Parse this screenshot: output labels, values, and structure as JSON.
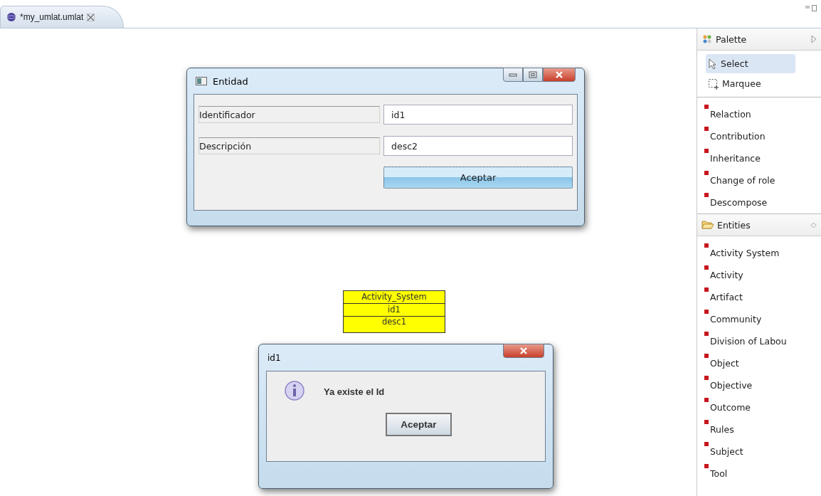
{
  "editor_tab": {
    "title": "*my_umlat.umlat"
  },
  "entity_dialog": {
    "title": "Entidad",
    "fields": [
      {
        "label": "Identificador",
        "value": "id1"
      },
      {
        "label": "Descripción",
        "value": "desc2"
      }
    ],
    "button": "Aceptar"
  },
  "diagram_node": {
    "title": "Activity_System",
    "rows": [
      "id1",
      "desc1"
    ]
  },
  "message_dialog": {
    "title": "id1",
    "message": "Ya existe el Id",
    "button": "Aceptar"
  },
  "palette": {
    "title": "Palette",
    "tools": [
      {
        "kind": "select",
        "label": "Select",
        "selected": true
      },
      {
        "kind": "marquee",
        "label": "Marquee",
        "selected": false
      }
    ],
    "relations": [
      "Relaction",
      "Contribution",
      "Inheritance",
      "Change of role",
      "Descompose"
    ],
    "entities": {
      "title": "Entities",
      "items": [
        "Activity System",
        "Activity",
        "Artifact",
        "Community",
        "Division of Labou",
        "Object",
        "Objective",
        "Outcome",
        "Rules",
        "Subject",
        "Tool"
      ]
    }
  }
}
